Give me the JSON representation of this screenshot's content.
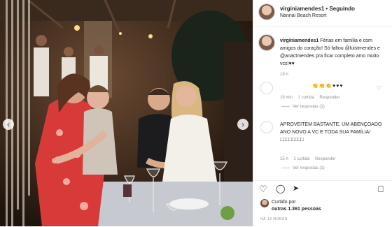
{
  "post": {
    "username": "virginiamendes1",
    "separator": "•",
    "follow_state": "Seguindo",
    "location": "Nannai Beach Resort",
    "caption_user": "virginiamendes1",
    "caption_text": " Férias em família e com amigos do coração! Só faltou @luistmendes e @anactmendes pra ficar completo amo muito vcs!",
    "caption_hearts": "♥♥",
    "caption_time": "19 h"
  },
  "comments": [
    {
      "text": "👏👏👏♥♥♥",
      "time": "19 min",
      "likes": "1 curtida",
      "reply": "Responder",
      "view_replies": "Ver respostas (1)"
    },
    {
      "text": "APROVEITEM BASTANTE, UM ABENÇOADO ANO NOVO A VC E TODA SUA FAMÍLIA! □□□□□□□□",
      "time": "15 h",
      "likes": "1 curtida",
      "reply": "Responder",
      "view_replies": "Ver respostas (1)"
    }
  ],
  "likes": {
    "prefix": "Curtido por",
    "text": "outras 1.361 pessoas"
  },
  "post_date": "HÁ 19 HORAS",
  "icons": {
    "heart": "heart-icon",
    "comment": "comment-icon",
    "share": "share-icon",
    "save": "bookmark-icon",
    "prev": "chevron-left-icon",
    "next": "chevron-right-icon"
  },
  "arrows": {
    "prev": "‹",
    "next": "›"
  },
  "glyphs": {
    "heart_outline": "♡",
    "comment": "◯",
    "share": "➤",
    "bookmark": "⎕"
  }
}
